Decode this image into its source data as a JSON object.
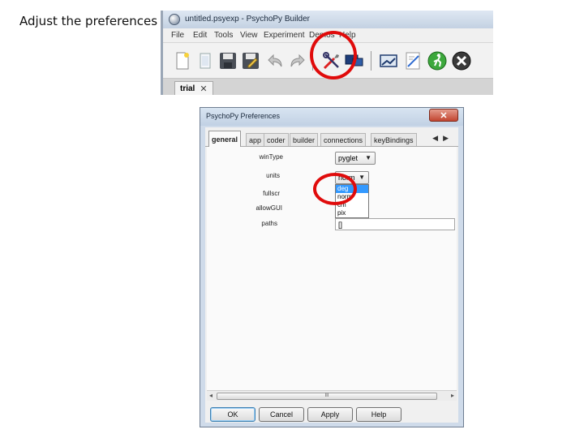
{
  "slide": {
    "title": "Adjust the preferences"
  },
  "builder": {
    "window_title": "untitled.psyexp - PsychoPy Builder",
    "menu": [
      "File",
      "Edit",
      "Tools",
      "View",
      "Experiment",
      "Demos",
      "Help"
    ],
    "toolbar_icons": [
      "new-file-icon",
      "open-file-icon",
      "save-icon",
      "save-as-icon",
      "undo-icon",
      "redo-icon",
      "preferences-icon",
      "monitor-center-icon",
      "experiment-settings-icon",
      "compile-script-icon",
      "run-icon",
      "stop-icon"
    ],
    "tab": {
      "label": "trial",
      "close": "✕"
    }
  },
  "preferences": {
    "title": "PsychoPy Preferences",
    "close": "✕",
    "tabs": [
      "general",
      "app",
      "coder",
      "builder",
      "connections",
      "keyBindings"
    ],
    "tab_arrows": "◀▶",
    "fields": {
      "winType": {
        "label": "winType",
        "value": "pyglet"
      },
      "units": {
        "label": "units",
        "value": "norm"
      },
      "fullscr": {
        "label": "fullscr"
      },
      "allowGUI": {
        "label": "allowGUI"
      },
      "paths": {
        "label": "paths",
        "value": "[]"
      }
    },
    "units_options": [
      "deg",
      "norm",
      "cm",
      "pix"
    ],
    "units_selected": "deg",
    "scroll_thumb": "III",
    "buttons": {
      "ok": "OK",
      "cancel": "Cancel",
      "apply": "Apply",
      "help": "Help"
    }
  },
  "colors": {
    "highlight_circle": "#e00b0b",
    "selection": "#3399ff"
  }
}
